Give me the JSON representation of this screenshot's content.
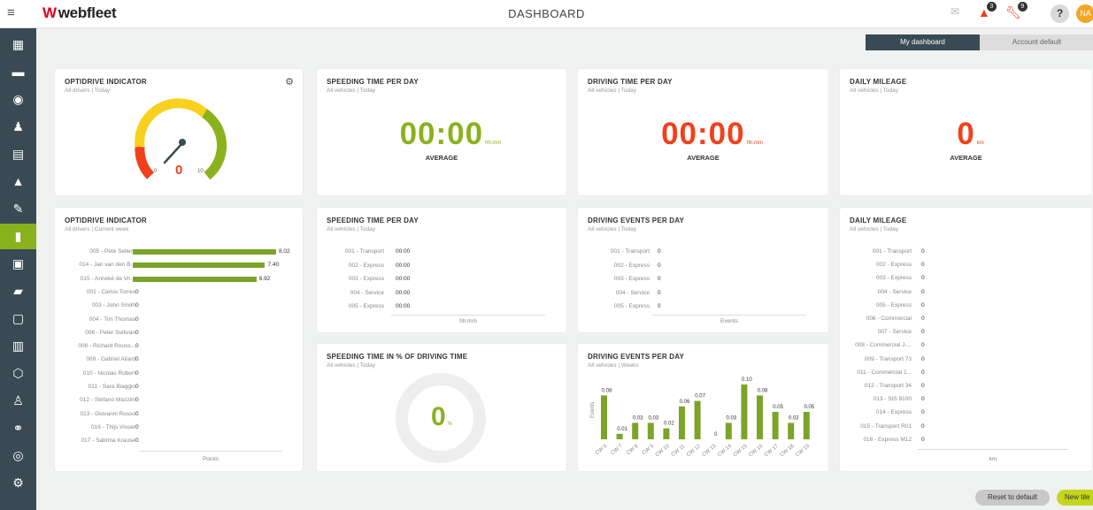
{
  "header": {
    "menu_icon": "hamburger-icon",
    "logo_mark": "W",
    "logo_text": "webfleet",
    "title": "DASHBOARD",
    "messages_icon": "envelope-icon",
    "alerts_count": "3",
    "service_count": "9",
    "help_label": "?",
    "avatar_initials": "NA"
  },
  "sidebar": {
    "items": [
      {
        "icon": "map-icon"
      },
      {
        "icon": "car-icon"
      },
      {
        "icon": "signal-icon"
      },
      {
        "icon": "driver-icon"
      },
      {
        "icon": "clipboard-icon"
      },
      {
        "icon": "warning-icon"
      },
      {
        "icon": "wrench-icon"
      },
      {
        "icon": "chart-icon",
        "active": true
      },
      {
        "icon": "report-icon"
      },
      {
        "icon": "truck-icon"
      },
      {
        "icon": "camera-icon"
      },
      {
        "icon": "building-icon"
      },
      {
        "icon": "area-icon"
      },
      {
        "icon": "user-icon"
      },
      {
        "icon": "network-icon"
      },
      {
        "icon": "target-icon"
      },
      {
        "icon": "settings-icon"
      }
    ]
  },
  "toggle": {
    "mine": "My dashboard",
    "account": "Account default"
  },
  "tiles": {
    "optidrive_gauge": {
      "title": "OPTIDRIVE INDICATOR",
      "subtitle": "All drivers | Today",
      "value": "0",
      "min": "0",
      "max": "10"
    },
    "speeding_time": {
      "title": "SPEEDING TIME PER DAY",
      "subtitle": "All vehicles | Today",
      "value": "00:00",
      "unit": "hh:mm",
      "avg": "AVERAGE"
    },
    "driving_time": {
      "title": "DRIVING TIME PER DAY",
      "subtitle": "All vehicles | Today",
      "value": "00:00",
      "unit": "hh:mm",
      "avg": "AVERAGE"
    },
    "daily_mileage": {
      "title": "DAILY MILEAGE",
      "subtitle": "All vehicles | Today",
      "value": "0",
      "unit": "km",
      "avg": "AVERAGE"
    },
    "optidrive_week": {
      "title": "OPTIDRIVE INDICATOR",
      "subtitle": "All drivers | Current week",
      "axis": "Points",
      "max": 8.02,
      "rows": [
        {
          "label": "005 - Pete Sellers",
          "value": 8.02,
          "display": "8.02"
        },
        {
          "label": "014 - Jan van den B...",
          "value": 7.4,
          "display": "7.40"
        },
        {
          "label": "015 - Anneké de Vri...",
          "value": 6.92,
          "display": "6.92"
        },
        {
          "label": "001 - Carlos Torres",
          "value": 0,
          "display": "0"
        },
        {
          "label": "003 - John Smith",
          "value": 0,
          "display": "0"
        },
        {
          "label": "004 - Tim Thomas",
          "value": 0,
          "display": "0"
        },
        {
          "label": "006 - Peter Sullivan",
          "value": 0,
          "display": "0"
        },
        {
          "label": "008 - Richard Rouss...",
          "value": 0,
          "display": "0"
        },
        {
          "label": "009 - Gabriel Allard",
          "value": 0,
          "display": "0"
        },
        {
          "label": "010 - Nicolas Robert",
          "value": 0,
          "display": "0"
        },
        {
          "label": "011 - Sara Biaggio",
          "value": 0,
          "display": "0"
        },
        {
          "label": "012 - Stefano Mazzini",
          "value": 0,
          "display": "0"
        },
        {
          "label": "013 - Giovanni Russo",
          "value": 0,
          "display": "0"
        },
        {
          "label": "016 - Thijs Visser",
          "value": 0,
          "display": "0"
        },
        {
          "label": "017 - Sabrina Krause",
          "value": 0,
          "display": "0"
        }
      ]
    },
    "speeding_list": {
      "title": "SPEEDING TIME PER DAY",
      "subtitle": "All vehicles | Today",
      "axis": "hh:mm",
      "rows": [
        {
          "label": "001 - Transport",
          "value": "00:00"
        },
        {
          "label": "002 - Express",
          "value": "00:00"
        },
        {
          "label": "003 - Express",
          "value": "00:00"
        },
        {
          "label": "004 - Service",
          "value": "00:00"
        },
        {
          "label": "005 - Express",
          "value": "00:00"
        }
      ]
    },
    "driving_events_list": {
      "title": "DRIVING EVENTS PER DAY",
      "subtitle": "All vehicles | Today",
      "axis": "Events",
      "rows": [
        {
          "label": "001 - Transport",
          "value": "0"
        },
        {
          "label": "002 - Express",
          "value": "0"
        },
        {
          "label": "003 - Express",
          "value": "0"
        },
        {
          "label": "004 - Service",
          "value": "0"
        },
        {
          "label": "005 - Express",
          "value": "0"
        }
      ]
    },
    "mileage_list": {
      "title": "DAILY MILEAGE",
      "subtitle": "All vehicles | Today",
      "axis": "km",
      "rows": [
        {
          "label": "001 - Transport",
          "value": "0"
        },
        {
          "label": "002 - Express",
          "value": "0"
        },
        {
          "label": "003 - Express",
          "value": "0"
        },
        {
          "label": "004 - Service",
          "value": "0"
        },
        {
          "label": "005 - Express",
          "value": "0"
        },
        {
          "label": "006 - Commercial",
          "value": "0"
        },
        {
          "label": "007 - Service",
          "value": "0"
        },
        {
          "label": "008 - Commercial J-...",
          "value": "0"
        },
        {
          "label": "009 - Transport 73",
          "value": "0"
        },
        {
          "label": "011 - Commercial 1...",
          "value": "0"
        },
        {
          "label": "012 - Transport 34",
          "value": "0"
        },
        {
          "label": "013 - StS 9100",
          "value": "0"
        },
        {
          "label": "014 - Express",
          "value": "0"
        },
        {
          "label": "015 - Transport R01",
          "value": "0"
        },
        {
          "label": "016 - Express M12",
          "value": "0"
        }
      ]
    },
    "speeding_percent": {
      "title": "SPEEDING TIME IN % OF DRIVING TIME",
      "subtitle": "All vehicles | Today",
      "value": "0",
      "unit": "%"
    },
    "driving_events_weeks": {
      "title": "DRIVING EVENTS PER DAY",
      "subtitle": "All vehicles | Weeks",
      "ylabel": "Events"
    }
  },
  "chart_data": {
    "type": "bar",
    "title": "DRIVING EVENTS PER DAY",
    "ylabel": "Events",
    "categories": [
      "CW 6",
      "CW 7",
      "CW 8",
      "CW 9",
      "CW 10",
      "CW 11",
      "CW 12",
      "CW 13",
      "CW 14",
      "CW 15",
      "CW 16",
      "CW 17",
      "CW 18",
      "CW 19"
    ],
    "values": [
      0.08,
      0.01,
      0.03,
      0.03,
      0.02,
      0.06,
      0.07,
      0,
      0.03,
      0.1,
      0.08,
      0.05,
      0.03,
      0.05
    ],
    "labels": [
      "0.08",
      "0.01",
      "0.03",
      "0.03",
      "0.02",
      "0.06",
      "0.07",
      "0",
      "0.03",
      "0.10",
      "0.08",
      "0.05",
      "0.03",
      "0.05"
    ],
    "ylim": [
      0,
      0.1
    ],
    "color": "#7ba428"
  },
  "footer": {
    "reset": "Reset to default",
    "new_tile": "New tile"
  },
  "colors": {
    "accent": "#8ab21d",
    "alert": "#f2401a",
    "sidebar": "#3a4a55"
  }
}
